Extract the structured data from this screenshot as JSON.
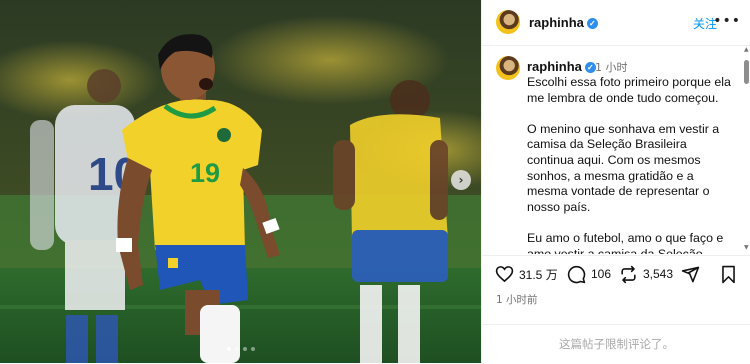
{
  "header": {
    "username": "raphinha",
    "follow_label": "关注",
    "more_icon": "more-horizontal-icon"
  },
  "post": {
    "username": "raphinha",
    "time_inline": "1 小时",
    "caption": [
      "Escolhi essa foto primeiro porque ela me lembra de onde tudo começou.",
      "O menino que sonhava em vestir a camisa da Seleção Brasileira continua aqui. Com os mesmos sonhos, a mesma gratidão e a mesma vontade de representar o nosso país.",
      "Eu amo o futebol, amo o que faço e amo vestir a camisa da Seleção Brasileira."
    ],
    "jersey_number": "19",
    "back_number": "10"
  },
  "actions": {
    "likes": "31.5 万",
    "comments": "106",
    "reposts": "3,543"
  },
  "post_time": "1 小时前",
  "footer": {
    "comments_limited": "这篇帖子限制评论了。"
  },
  "carousel": {
    "slide_count": 4,
    "current": 1
  },
  "colors": {
    "accent": "#0095f6",
    "verified": "#2e8ff0",
    "jersey_yellow": "#f2d12b",
    "shorts_blue": "#1f56b8",
    "jersey_green": "#1f9a45"
  }
}
